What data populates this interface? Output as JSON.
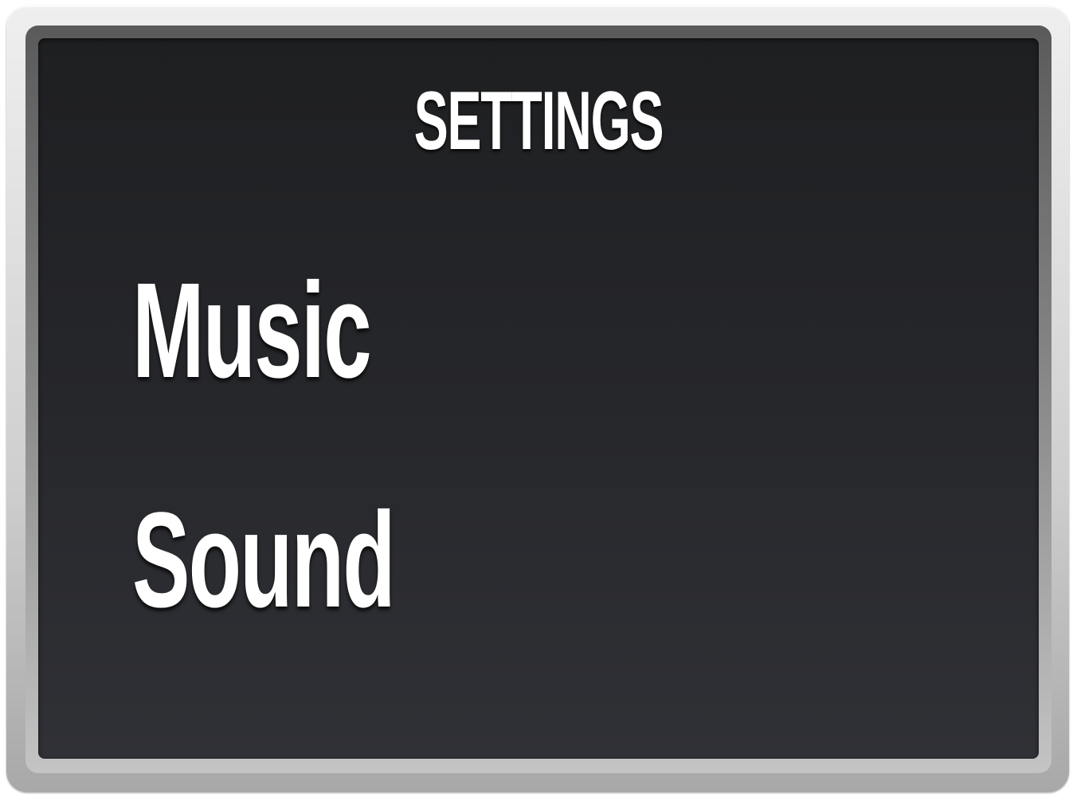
{
  "screen": {
    "title": "SETTINGS",
    "menu_items": [
      {
        "label": "Music"
      },
      {
        "label": "Sound"
      }
    ]
  },
  "colors": {
    "screen_background": "#26272b",
    "text": "#ffffff",
    "frame": "#cfcfcf"
  }
}
